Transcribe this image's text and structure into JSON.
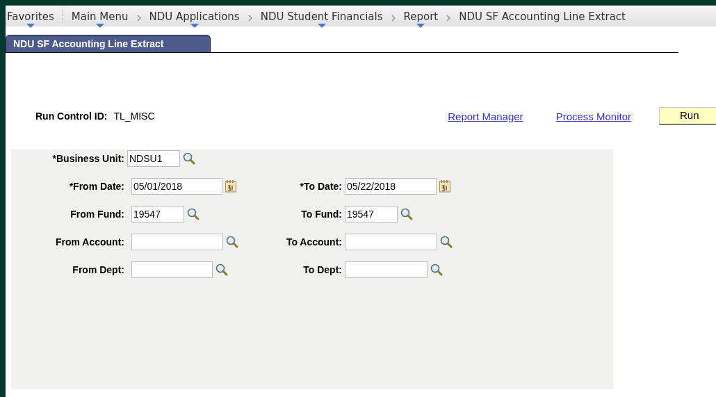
{
  "breadcrumbs": [
    {
      "label": "Favorites",
      "menu": true
    },
    {
      "label": "Main Menu",
      "menu": true
    },
    {
      "label": "NDU Applications",
      "menu": true
    },
    {
      "label": "NDU Student Financials",
      "menu": true
    },
    {
      "label": "Report",
      "menu": true
    },
    {
      "label": "NDU SF Accounting Line Extract",
      "menu": false
    }
  ],
  "tab": {
    "label": "NDU SF Accounting Line Extract",
    "selected": true
  },
  "run_control": {
    "label": "Run Control ID:",
    "value": "TL_MISC"
  },
  "links": [
    "Report Manager",
    "Process Monitor"
  ],
  "run_button": "Run",
  "criteria": [
    [
      {
        "label": "*Business Unit:",
        "value": "NDSU1",
        "kind": "lookup"
      }
    ],
    [
      {
        "label": "*From Date:",
        "value": "05/01/2018",
        "kind": "date"
      },
      {
        "label": "*To Date:",
        "value": "05/22/2018",
        "kind": "date"
      }
    ],
    [
      {
        "label": "From Fund:",
        "value": "19547",
        "kind": "lookup"
      },
      {
        "label": "To Fund:",
        "value": "19547",
        "kind": "lookup"
      }
    ],
    [
      {
        "label": "From Account:",
        "kind": "lookup"
      },
      {
        "label": "To Account:",
        "kind": "lookup"
      }
    ],
    [
      {
        "label": "From Dept:",
        "kind": "lookup"
      },
      {
        "label": "To Dept:",
        "kind": "lookup"
      }
    ]
  ]
}
